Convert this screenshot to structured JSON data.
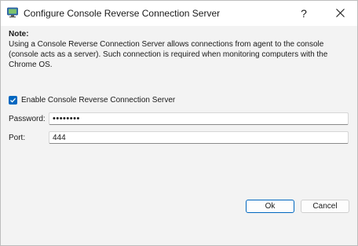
{
  "window": {
    "title": "Configure Console Reverse Connection Server",
    "help_glyph": "?",
    "close_glyph": "✕"
  },
  "note": {
    "heading": "Note:",
    "text": "Using a Console Reverse Connection Server allows connections from agent to the console (console acts as a server). Such connection is required when monitoring computers with the Chrome OS."
  },
  "enable_checkbox": {
    "label": "Enable Console Reverse Connection Server",
    "checked": true
  },
  "password": {
    "label": "Password:",
    "value": "••••••••"
  },
  "port": {
    "label": "Port:",
    "value": "444"
  },
  "buttons": {
    "ok": "Ok",
    "cancel": "Cancel"
  },
  "colors": {
    "accent": "#0067c0",
    "background": "#f3f3f3"
  }
}
